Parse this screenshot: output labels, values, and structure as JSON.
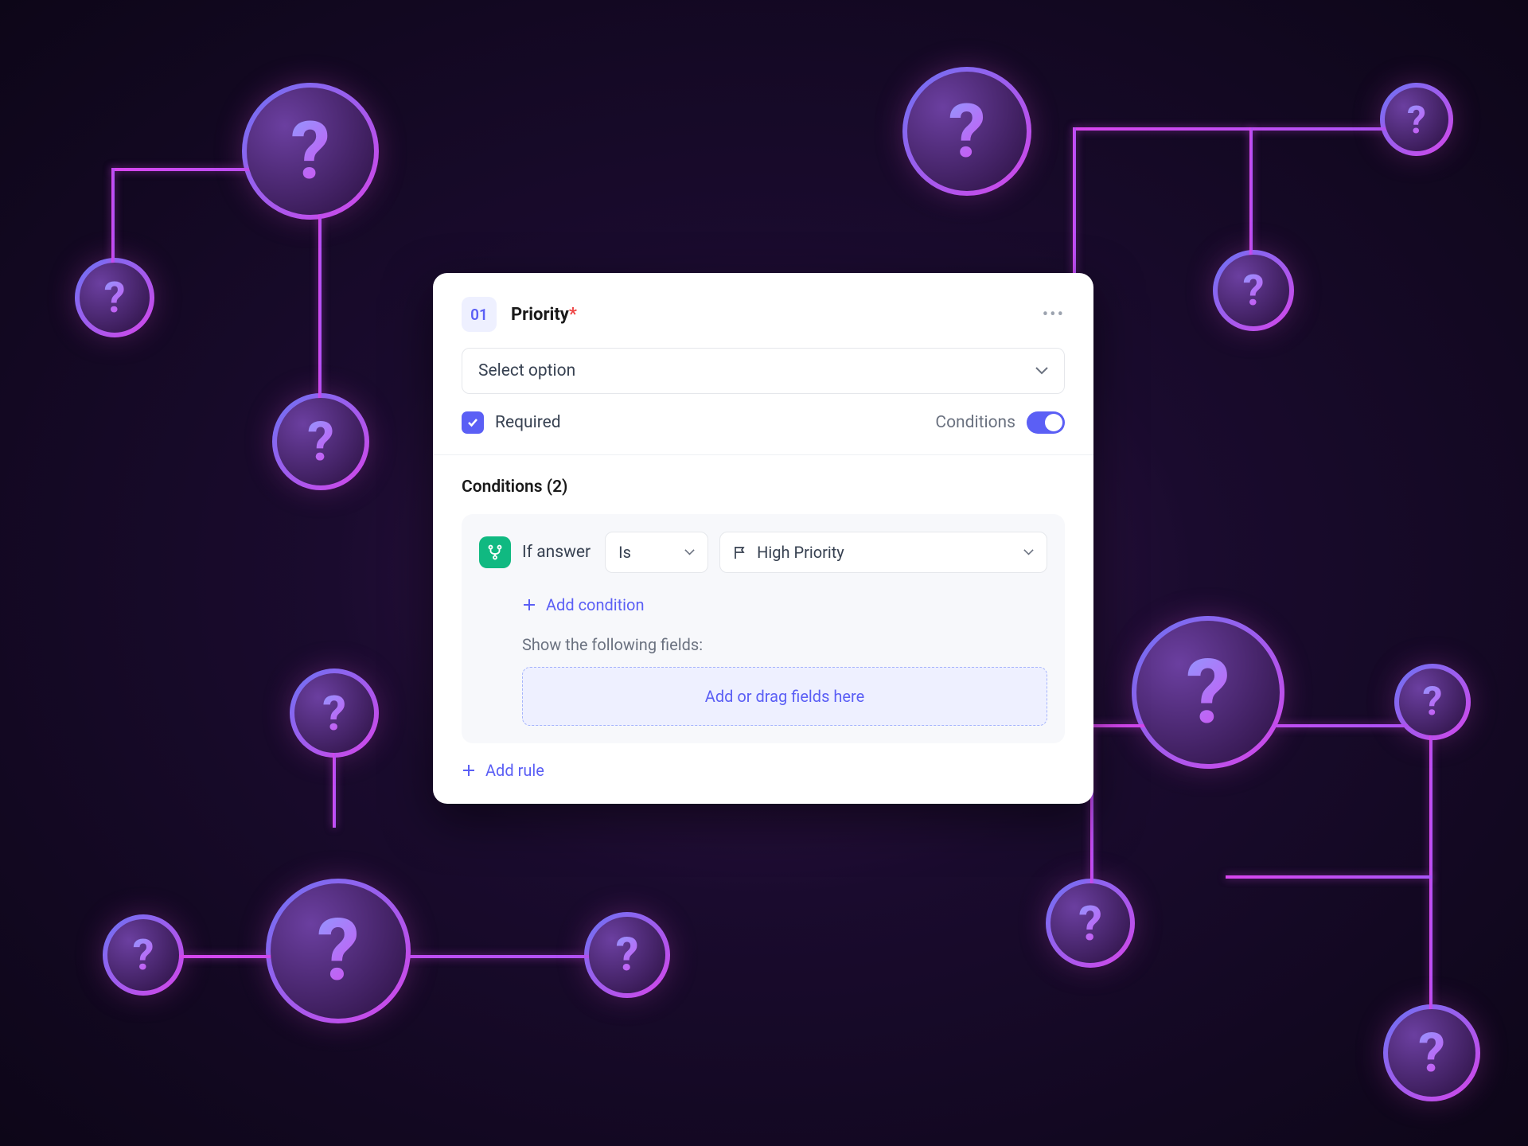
{
  "header": {
    "number": "01",
    "title": "Priority",
    "required_marker": "*"
  },
  "select": {
    "placeholder": "Select option"
  },
  "required": {
    "label": "Required",
    "checked": true
  },
  "conditions_toggle": {
    "label": "Conditions",
    "on": true
  },
  "conditions": {
    "title": "Conditions (2)",
    "if_answer_label": "If answer",
    "operator": "Is",
    "value": "High Priority",
    "add_condition_label": "Add condition",
    "show_fields_label": "Show the following fields:",
    "drop_zone_label": "Add or drag fields here",
    "add_rule_label": "Add rule"
  }
}
